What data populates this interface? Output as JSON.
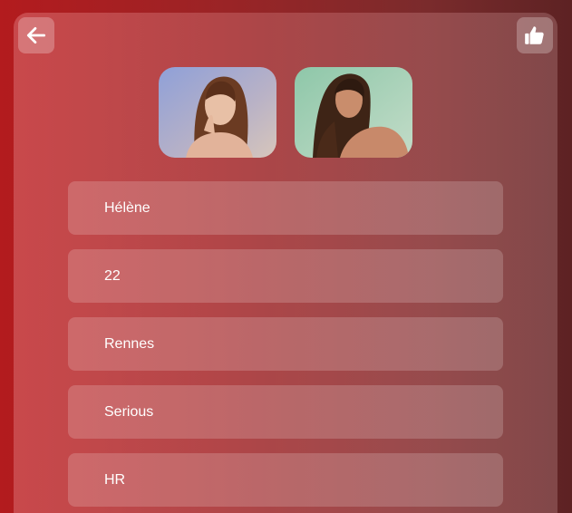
{
  "nav": {
    "back_icon": "arrow-left-icon",
    "like_icon": "thumbs-up-icon"
  },
  "photos": [
    {
      "alt": "profile photo 1"
    },
    {
      "alt": "profile photo 2"
    }
  ],
  "profile": {
    "name": "Hélène",
    "age": "22",
    "city": "Rennes",
    "relationship": "Serious",
    "job": "HR"
  },
  "colors": {
    "accent": "#b31b1e",
    "text": "#ffffff"
  }
}
